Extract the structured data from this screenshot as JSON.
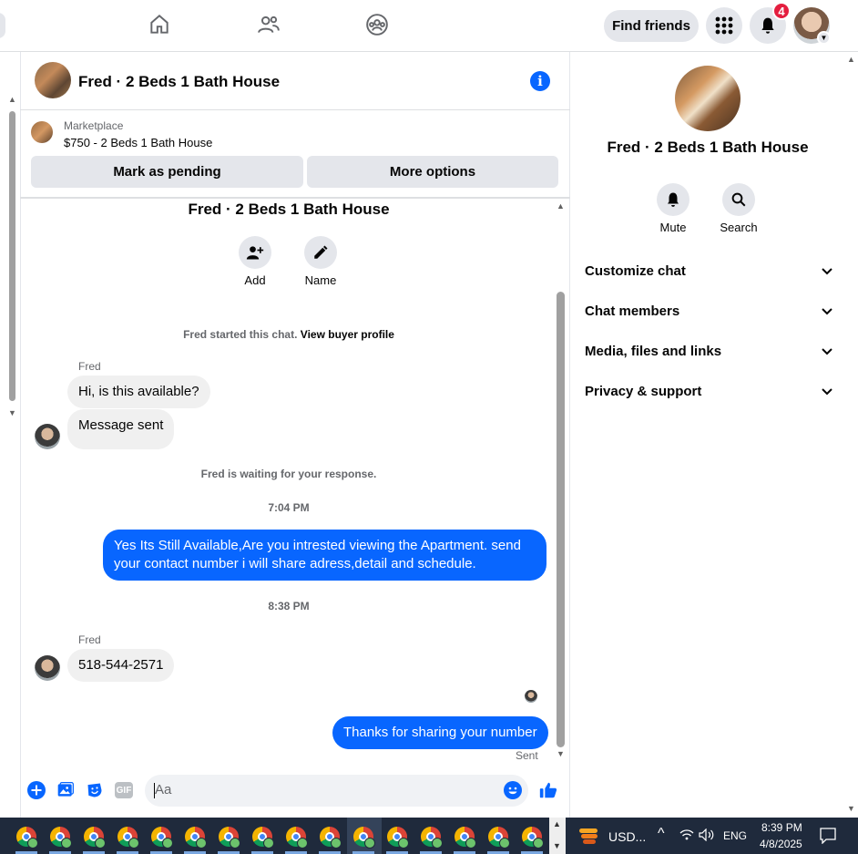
{
  "topnav": {
    "find_friends": "Find friends",
    "notification_count": "4"
  },
  "chat": {
    "title": "Fred · 2 Beds 1 Bath House",
    "marketplace_label": "Marketplace",
    "listing": "$750 - 2 Beds 1 Bath House",
    "mark_pending": "Mark as pending",
    "more_options": "More options"
  },
  "thread": {
    "title": "Fred · 2 Beds 1 Bath House",
    "actions": [
      {
        "label": "Add",
        "icon": "add-person-icon"
      },
      {
        "label": "Name",
        "icon": "pencil-icon"
      }
    ],
    "started_text": "Fred started this chat.",
    "buyer_profile_link": "View buyer profile",
    "messages": [
      {
        "sender": "Fred",
        "text": "Hi, is this available?"
      },
      {
        "text": "Message sent"
      },
      {
        "system": "Fred is waiting for your response."
      },
      {
        "time": "7:04 PM"
      },
      {
        "outgoing": "Yes Its Still Available,Are you intrested viewing the Apartment. send your contact number i will share adress,detail and schedule."
      },
      {
        "time": "8:38 PM"
      },
      {
        "sender": "Fred",
        "text": "518-544-2571"
      },
      {
        "outgoing": "Thanks for sharing your number",
        "status": "Sent"
      }
    ]
  },
  "composer": {
    "placeholder": "Aa",
    "gif_label": "GIF"
  },
  "right_panel": {
    "title": "Fred · 2 Beds 1 Bath House",
    "actions": [
      {
        "label": "Mute",
        "icon": "bell-icon"
      },
      {
        "label": "Search",
        "icon": "search-icon"
      }
    ],
    "sections": [
      "Customize chat",
      "Chat members",
      "Media, files and links",
      "Privacy & support"
    ]
  },
  "taskbar": {
    "currency": "USD...",
    "language": "ENG",
    "time": "8:39 PM",
    "date": "4/8/2025"
  },
  "colors": {
    "accent": "#0866ff",
    "badge": "#e41e3f",
    "bubble_in": "#f0f0f0"
  }
}
